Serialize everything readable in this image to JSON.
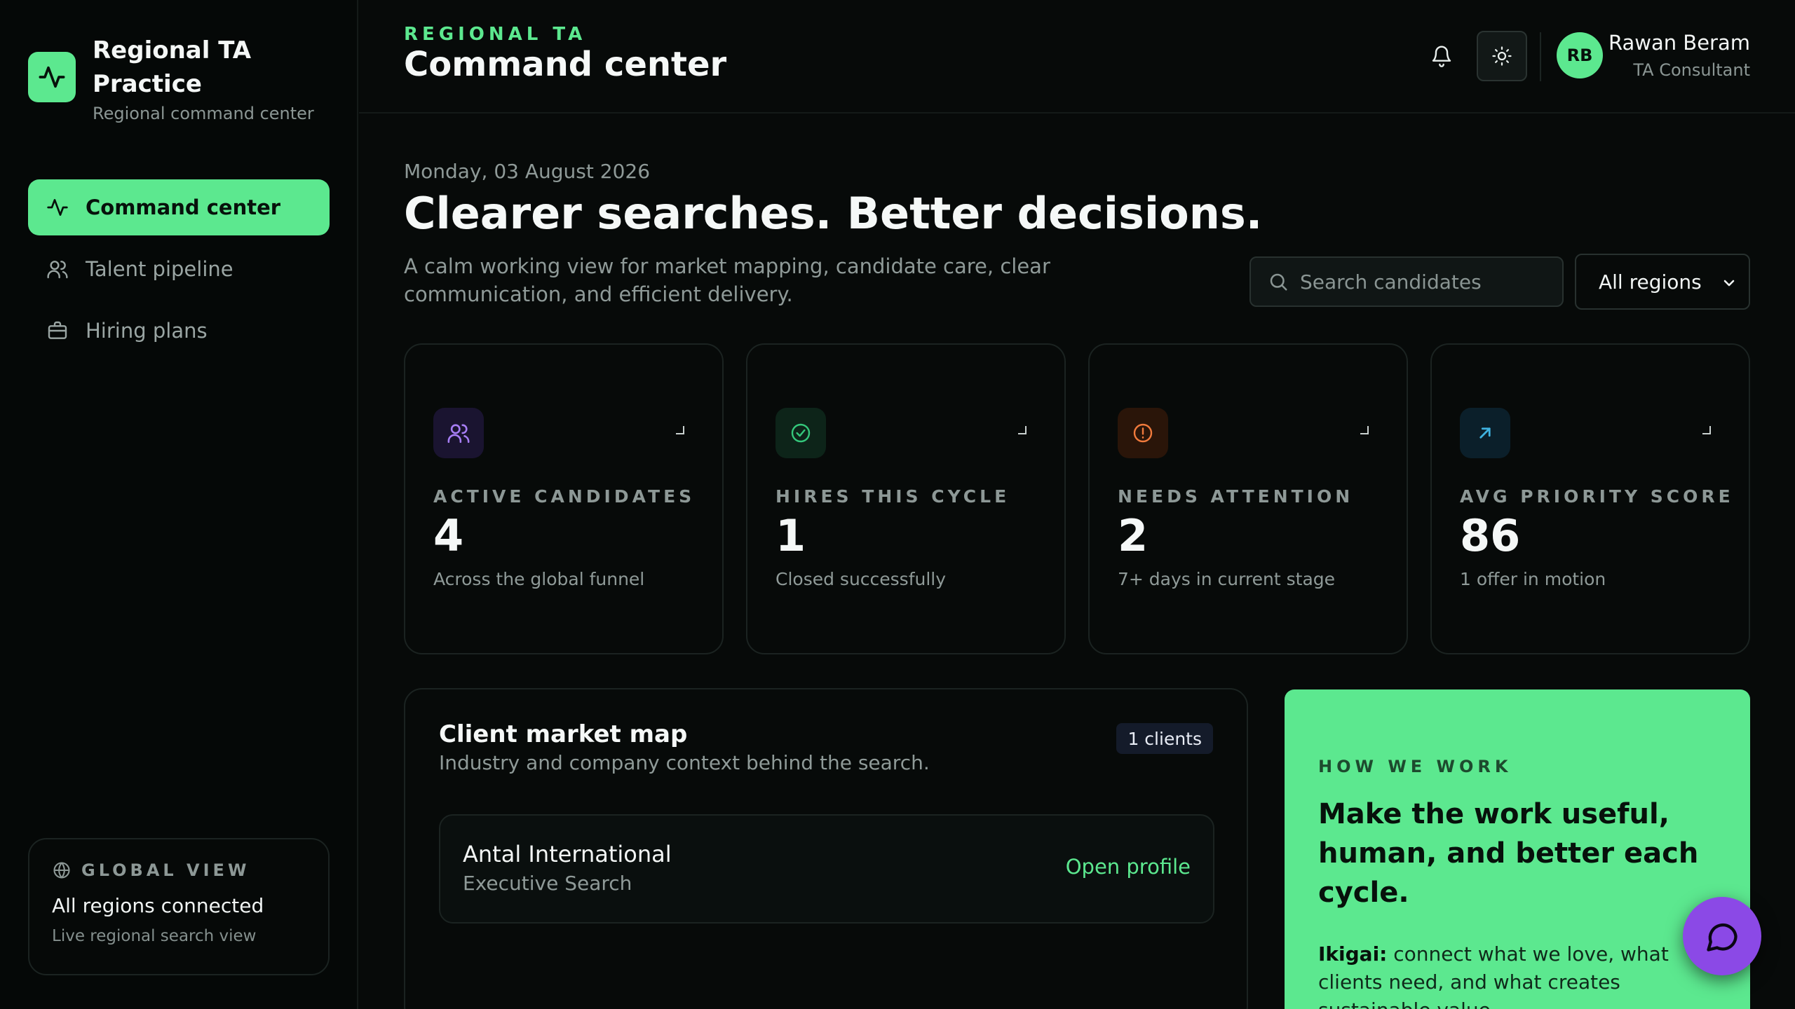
{
  "brand": {
    "name": "Regional TA Practice",
    "subtitle": "Regional command center"
  },
  "nav": {
    "items": [
      {
        "label": "Command center",
        "icon": "activity-icon",
        "active": true
      },
      {
        "label": "Talent pipeline",
        "icon": "users-icon",
        "active": false
      },
      {
        "label": "Hiring plans",
        "icon": "briefcase-icon",
        "active": false
      }
    ]
  },
  "global_view": {
    "title": "GLOBAL VIEW",
    "status": "All regions connected",
    "detail": "Live regional search view"
  },
  "header": {
    "eyebrow": "REGIONAL TA",
    "title": "Command center",
    "user": {
      "initials": "RB",
      "name": "Rawan Beram",
      "role": "TA Consultant"
    }
  },
  "main": {
    "date": "Monday, 03 August 2026",
    "headline": "Clearer searches. Better decisions.",
    "intro": "A calm working view for market mapping, candidate care, clear communication, and efficient delivery.",
    "search": {
      "placeholder": "Search candidates"
    },
    "region_filter": {
      "selected": "All regions"
    }
  },
  "kpis": [
    {
      "label": "ACTIVE CANDIDATES",
      "value": "4",
      "sub": "Across the global funnel",
      "icon": "users-icon",
      "color": "#a77ef5"
    },
    {
      "label": "HIRES THIS CYCLE",
      "value": "1",
      "sub": "Closed successfully",
      "icon": "check-circle-icon",
      "color": "#34c77b"
    },
    {
      "label": "NEEDS ATTENTION",
      "value": "2",
      "sub": "7+ days in current stage",
      "icon": "alert-circle-icon",
      "color": "#f07a3c"
    },
    {
      "label": "AVG PRIORITY SCORE",
      "value": "86",
      "sub": "1 offer in motion",
      "icon": "arrow-up-right-icon",
      "color": "#3fb2e0"
    }
  ],
  "market_map": {
    "title": "Client market map",
    "subtitle": "Industry and company context behind the search.",
    "badge": "1 clients",
    "clients": [
      {
        "name": "Antal International",
        "type": "Executive Search",
        "action": "Open profile"
      }
    ]
  },
  "how_we_work": {
    "eyebrow": "HOW WE WORK",
    "title": "Make the work useful, human, and better each cycle.",
    "lead": "Ikigai:",
    "text": " connect what we love, what clients need, and what creates sustainable value."
  },
  "colors": {
    "accent": "#5ce88f",
    "background": "#070a09",
    "chat": "#8b49e6"
  }
}
